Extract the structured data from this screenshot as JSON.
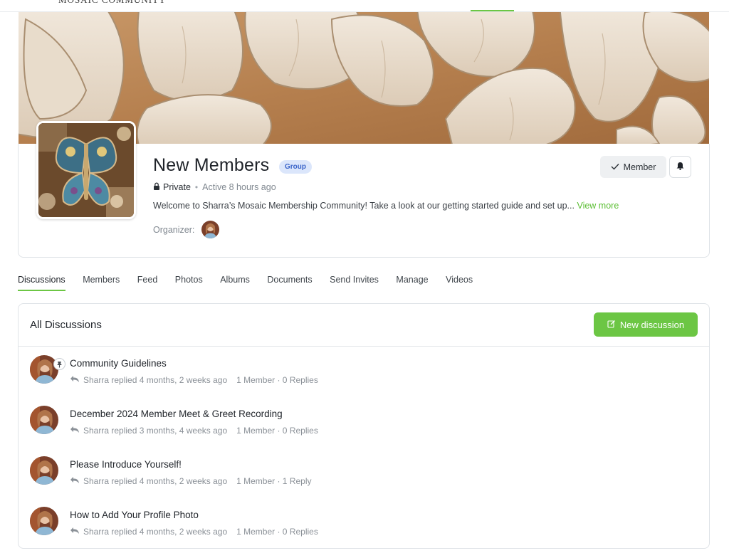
{
  "site": {
    "brand": "MOSAIC COMMUNITY"
  },
  "group": {
    "title": "New Members",
    "badge": "Group",
    "privacy": "Private",
    "separator": "•",
    "activity": "Active 8 hours ago",
    "description": "Welcome to Sharra’s Mosaic Membership Community! Take a look at our getting started guide and set up...",
    "view_more": "View more",
    "organizer_label": "Organizer:",
    "member_button": "Member"
  },
  "tabs": [
    {
      "label": "Discussions",
      "active": true
    },
    {
      "label": "Members"
    },
    {
      "label": "Feed"
    },
    {
      "label": "Photos"
    },
    {
      "label": "Albums"
    },
    {
      "label": "Documents"
    },
    {
      "label": "Send Invites"
    },
    {
      "label": "Manage"
    },
    {
      "label": "Videos"
    }
  ],
  "discussions": {
    "heading": "All Discussions",
    "new_button": "New discussion",
    "items": [
      {
        "title": "Community Guidelines",
        "meta": "Sharra replied 4 months, 2 weeks ago",
        "stats": "1 Member · 0 Replies",
        "pinned": true
      },
      {
        "title": "December 2024 Member Meet & Greet Recording",
        "meta": "Sharra replied 3 months, 4 weeks ago",
        "stats": "1 Member · 0 Replies"
      },
      {
        "title": "Please Introduce Yourself!",
        "meta": "Sharra replied 4 months, 2 weeks ago",
        "stats": "1 Member · 1 Reply"
      },
      {
        "title": "How to Add Your Profile Photo",
        "meta": "Sharra replied 4 months, 2 weeks ago",
        "stats": "1 Member · 0 Replies"
      }
    ]
  },
  "colors": {
    "accent_green": "#6cc644",
    "badge_blue_bg": "#dbe6fb",
    "badge_blue_text": "#3a64c9"
  },
  "icons": {
    "privacy": "lock-icon",
    "member_check": "check-icon",
    "notifications": "bell-icon",
    "new_discussion": "edit-icon",
    "reply": "reply-icon",
    "pinned": "pin-icon"
  }
}
